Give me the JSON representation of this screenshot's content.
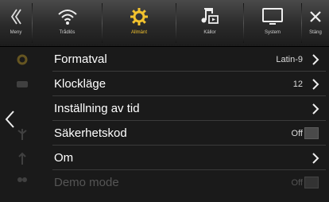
{
  "topbar": {
    "meny_label": "Meny",
    "tradlos_label": "Trådlös",
    "allmant_label": "Allmänt",
    "kallor_label": "Källor",
    "system_label": "System",
    "stang_label": "Stäng"
  },
  "settings": [
    {
      "label": "Formatval",
      "value": "Latin-9"
    },
    {
      "label": "Klockläge",
      "value": "12"
    },
    {
      "label": "Inställning av tid",
      "value": ""
    },
    {
      "label": "Säkerhetskod",
      "value": "Off"
    },
    {
      "label": "Om",
      "value": ""
    },
    {
      "label": "Demo mode",
      "value": "Off"
    }
  ],
  "colors": {
    "accent": "#f2c22e",
    "background": "#1a1a1a"
  },
  "active_tab": "Allmänt"
}
